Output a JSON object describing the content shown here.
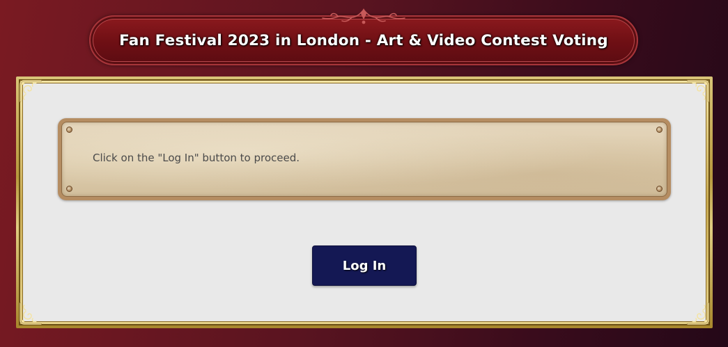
{
  "header": {
    "title": "Fan Festival 2023 in London - Art & Video Contest Voting",
    "ornament_icon": "scroll-ornament-icon"
  },
  "main": {
    "message": "Click on the \"Log In\" button to proceed.",
    "login_label": "Log In"
  },
  "colors": {
    "background_left": "#7a1a22",
    "background_right": "#240818",
    "banner": "#6e0f14",
    "frame_gold": "#c9ab52",
    "panel": "#e9e9e9",
    "parchment": "#dccbab",
    "button": "#141854"
  },
  "icons": {
    "frame_corner": "ornate-corner-icon",
    "box_rivet": "rivet-icon"
  }
}
